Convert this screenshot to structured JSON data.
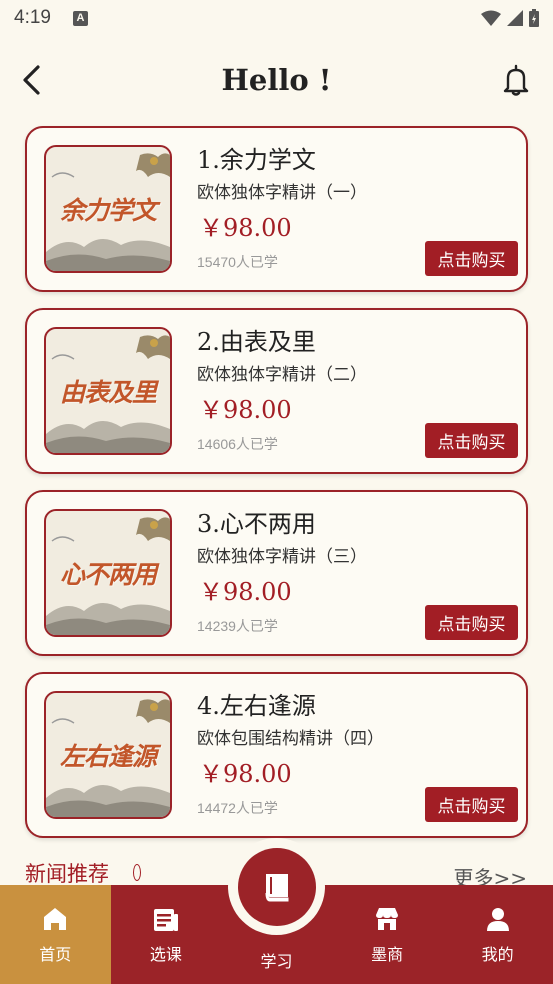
{
  "status": {
    "time": "4:19",
    "a_icon": "A"
  },
  "header": {
    "title": "Hello !"
  },
  "courses": [
    {
      "title": "1.余力学文",
      "subtitle": "欧体独体字精讲（一）",
      "price": "￥98.00",
      "learners": "15470人已学",
      "thumb_text": "余力学文",
      "buy_label": "点击购买"
    },
    {
      "title": "2.由表及里",
      "subtitle": "欧体独体字精讲（二）",
      "price": "￥98.00",
      "learners": "14606人已学",
      "thumb_text": "由表及里",
      "buy_label": "点击购买"
    },
    {
      "title": "3.心不两用",
      "subtitle": "欧体独体字精讲（三）",
      "price": "￥98.00",
      "learners": "14239人已学",
      "thumb_text": "心不两用",
      "buy_label": "点击购买"
    },
    {
      "title": "4.左右逢源",
      "subtitle": "欧体包围结构精讲（四）",
      "price": "￥98.00",
      "learners": "14472人已学",
      "thumb_text": "左右逢源",
      "buy_label": "点击购买"
    }
  ],
  "news": {
    "title": "新闻推荐",
    "more": "更多>>"
  },
  "nav": [
    {
      "label": "首页",
      "icon": "home-icon"
    },
    {
      "label": "选课",
      "icon": "course-list-icon"
    },
    {
      "label": "学习",
      "icon": "book-icon"
    },
    {
      "label": "墨商",
      "icon": "store-icon"
    },
    {
      "label": "我的",
      "icon": "user-icon"
    }
  ],
  "colors": {
    "accent": "#9b2328",
    "price": "#a21e25",
    "active_nav": "#c9913f",
    "background": "#fbf8ee"
  }
}
